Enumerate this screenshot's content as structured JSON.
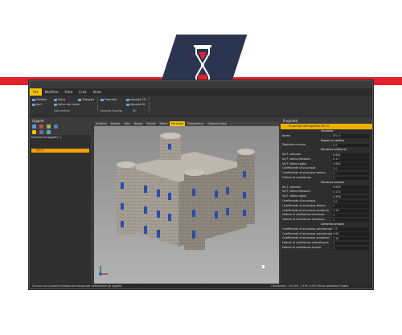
{
  "menu": [
    "File",
    "Modifica",
    "Vista",
    "Crea",
    "Aiuto"
  ],
  "ribbon": {
    "b1": "Modello",
    "b2": "Apri",
    "b3": "Salva",
    "b4": "Salva con nome",
    "b5": "Triangola",
    "b6": "Proprietà",
    "b7": "Importa STL",
    "b8": "Importa Stl",
    "h1": "Documento",
    "h2": "Importa Esporta",
    "h3": "Stl"
  },
  "left": {
    "title": "Oggetti",
    "count": "Numero di oggetti: 1",
    "item": "SFC.0"
  },
  "tabs": [
    "Sinistra",
    "Destra",
    "Alto",
    "Basso",
    "Fronte",
    "Retro",
    "Parallela",
    "Prospettica",
    "Opzioni vista"
  ],
  "selected_tab": "Parallela",
  "props": {
    "title": "Proprietà",
    "bar": "Proprietà dell'oggetto SFC.0",
    "rows": [
      {
        "k": "Generale",
        "v": "",
        "hdr": true
      },
      {
        "k": "Nome",
        "v": "SFC.0"
      },
      {
        "k": "Regola di verifica",
        "v": "",
        "hdr": true
      },
      {
        "k": "Tagliante minimo",
        "v": "0.0"
      },
      {
        "k": "Muratura ordinaria",
        "v": "",
        "hdr": true
      },
      {
        "k": "Sh/T verticale",
        "v": "0.862"
      },
      {
        "k": "Sh/T ultimo flessione",
        "v": "0.17"
      },
      {
        "k": "Sh/T ultimo taglio",
        "v": "0.882"
      },
      {
        "k": "Coefficiente di sicurezza",
        "v": "2.0"
      },
      {
        "k": "Coefficiente di sicurezza statica",
        "v": "2"
      },
      {
        "k": "Fattore di confidenza",
        "v": "1"
      },
      {
        "k": "Muratura armata",
        "v": "",
        "hdr": true
      },
      {
        "k": "Sh/T verticale",
        "v": "0.869"
      },
      {
        "k": "Sh/T ultimo flessione",
        "v": "0.174"
      },
      {
        "k": "Sh/T ultimo taglio",
        "v": "0.998"
      },
      {
        "k": "Coefficiente di sicurezza",
        "v": "2.0"
      },
      {
        "k": "Coefficiente di sicurezza statica",
        "v": "2"
      },
      {
        "k": "Coefficiente di sicurezza armatura",
        "v": "1.15"
      },
      {
        "k": "Fattore di confidenza armatura",
        "v": "1"
      },
      {
        "k": "Fattore di confidenza muratura",
        "v": "1"
      },
      {
        "k": "Cemento armato",
        "v": "",
        "hdr": true
      },
      {
        "k": "Coefficiente di sicurezza calcestruzzo",
        "v": "1.5"
      },
      {
        "k": "Coefficiente di sicurezza calcestruzzo",
        "v": "0.85"
      },
      {
        "k": "Coefficiente di sicurezza armatura",
        "v": "1.15"
      },
      {
        "k": "Fattore di confidenza calcestruzzo",
        "v": "1"
      },
      {
        "k": "Fattore di confidenza acciaio",
        "v": "1"
      }
    ]
  },
  "status": {
    "left": "Cliccare sui pulsanti sinistro del mouse per selezionare gli oggetti",
    "right": "Coordinate: -10.001, 1.339, 0.000  Filtro selezione  Griglia"
  }
}
